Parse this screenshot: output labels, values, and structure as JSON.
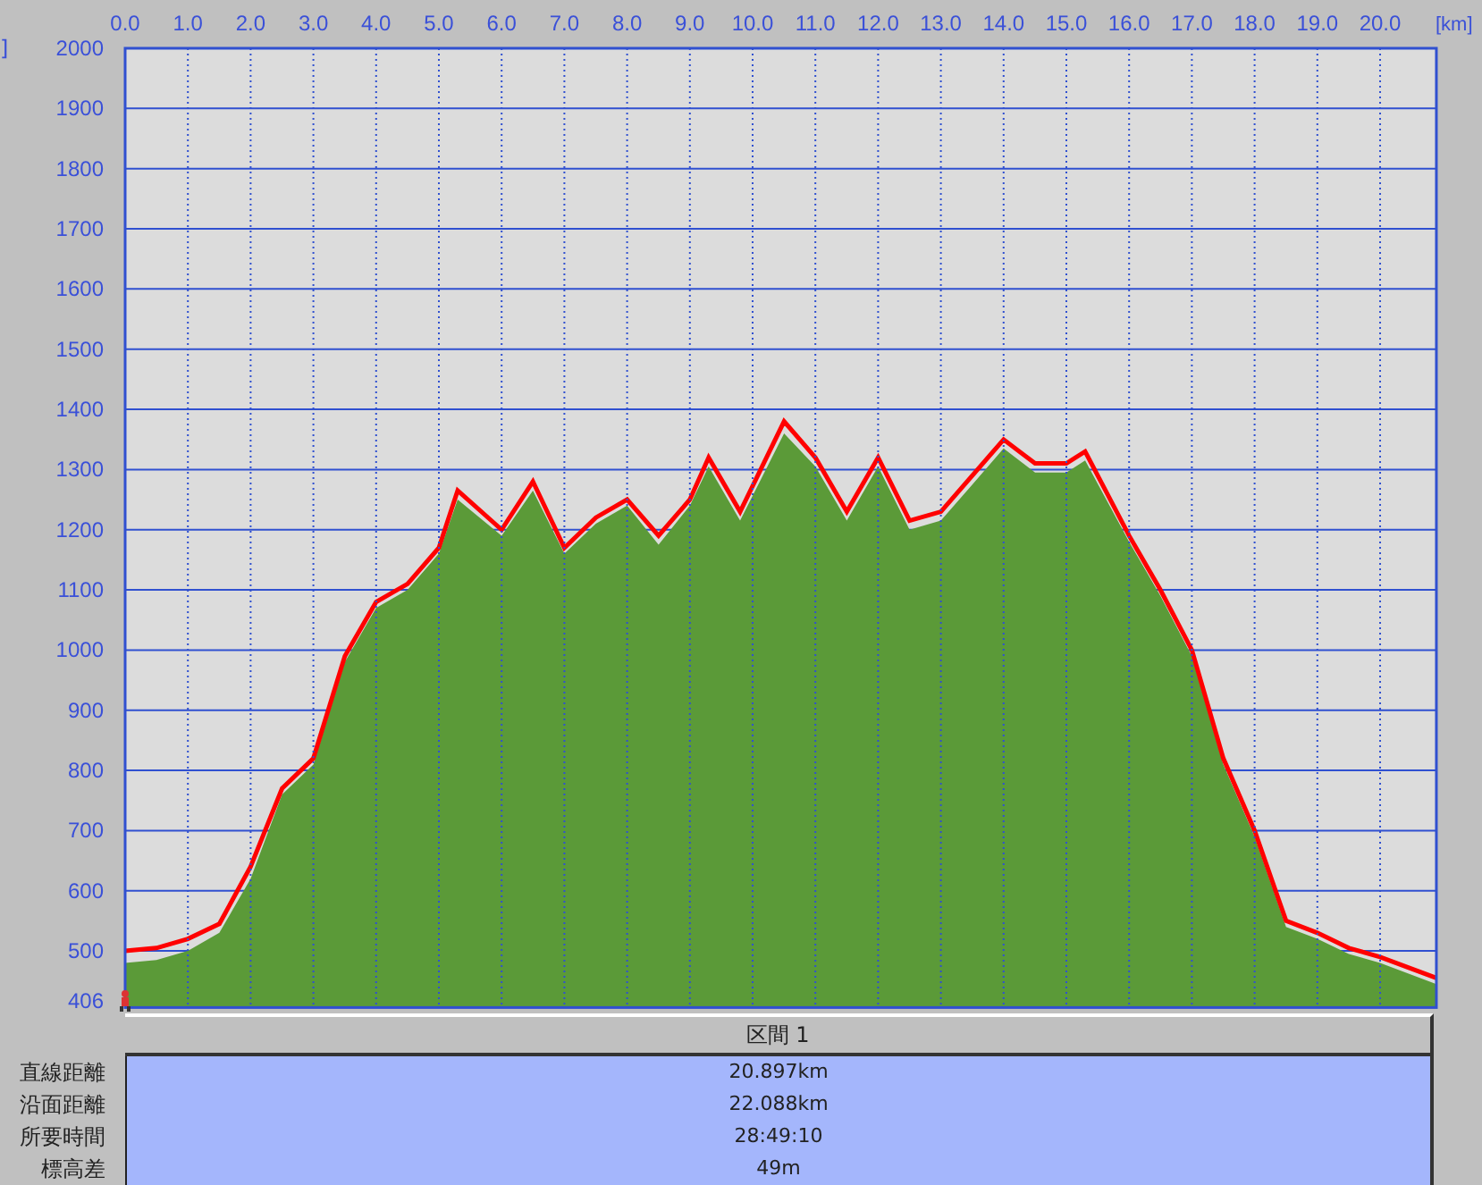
{
  "chart": {
    "chart_data": {
      "type": "area",
      "xlabel": "[km]",
      "ylabel": "]",
      "x": [
        0,
        0.5,
        1,
        1.5,
        2,
        2.5,
        3,
        3.5,
        4,
        4.5,
        5,
        5.3,
        6,
        6.5,
        7,
        7.5,
        8,
        8.5,
        9,
        9.3,
        9.8,
        10.5,
        11,
        11.5,
        12,
        12.5,
        13,
        13.5,
        14,
        14.5,
        15,
        15.3,
        16,
        16.5,
        17,
        17.5,
        18,
        18.5,
        19,
        19.5,
        20,
        20.897
      ],
      "series": [
        {
          "type": "area",
          "color": "#5b9a38",
          "values": [
            480,
            485,
            500,
            530,
            620,
            760,
            810,
            980,
            1070,
            1100,
            1160,
            1250,
            1190,
            1265,
            1160,
            1210,
            1240,
            1175,
            1240,
            1305,
            1215,
            1360,
            1305,
            1215,
            1305,
            1200,
            1215,
            1275,
            1335,
            1295,
            1295,
            1315,
            1180,
            1090,
            990,
            810,
            690,
            540,
            520,
            495,
            480,
            445
          ]
        },
        {
          "type": "line",
          "color": "#ff0000",
          "values": [
            500,
            505,
            520,
            545,
            640,
            770,
            820,
            990,
            1080,
            1110,
            1170,
            1265,
            1200,
            1280,
            1170,
            1220,
            1250,
            1190,
            1250,
            1320,
            1230,
            1380,
            1320,
            1230,
            1320,
            1215,
            1230,
            1290,
            1350,
            1310,
            1310,
            1330,
            1190,
            1100,
            1000,
            820,
            700,
            550,
            530,
            505,
            490,
            455
          ]
        }
      ],
      "grid": true,
      "xlim": [
        0,
        20.897
      ],
      "ylim": [
        406,
        2000
      ],
      "xticks": [
        {
          "value": 0,
          "label": "0.0"
        },
        {
          "value": 1,
          "label": "1.0"
        },
        {
          "value": 2,
          "label": "2.0"
        },
        {
          "value": 3,
          "label": "3.0"
        },
        {
          "value": 4,
          "label": "4.0"
        },
        {
          "value": 5,
          "label": "5.0"
        },
        {
          "value": 6,
          "label": "6.0"
        },
        {
          "value": 7,
          "label": "7.0"
        },
        {
          "value": 8,
          "label": "8.0"
        },
        {
          "value": 9,
          "label": "9.0"
        },
        {
          "value": 10,
          "label": "10.0"
        },
        {
          "value": 11,
          "label": "11.0"
        },
        {
          "value": 12,
          "label": "12.0"
        },
        {
          "value": 13,
          "label": "13.0"
        },
        {
          "value": 14,
          "label": "14.0"
        },
        {
          "value": 15,
          "label": "15.0"
        },
        {
          "value": 16,
          "label": "16.0"
        },
        {
          "value": 17,
          "label": "17.0"
        },
        {
          "value": 18,
          "label": "18.0"
        },
        {
          "value": 19,
          "label": "19.0"
        },
        {
          "value": 20,
          "label": "20.0"
        }
      ],
      "yticks": [
        406,
        500,
        600,
        700,
        800,
        900,
        1000,
        1100,
        1200,
        1300,
        1400,
        1500,
        1600,
        1700,
        1800,
        1900,
        2000
      ]
    }
  },
  "table": {
    "header": "区間 1",
    "rows": [
      {
        "label": "直線距離",
        "value": "20.897km"
      },
      {
        "label": "沿面距離",
        "value": "22.088km"
      },
      {
        "label": "所要時間",
        "value": "28:49:10"
      },
      {
        "label": "標高差",
        "value": "49m"
      }
    ]
  }
}
